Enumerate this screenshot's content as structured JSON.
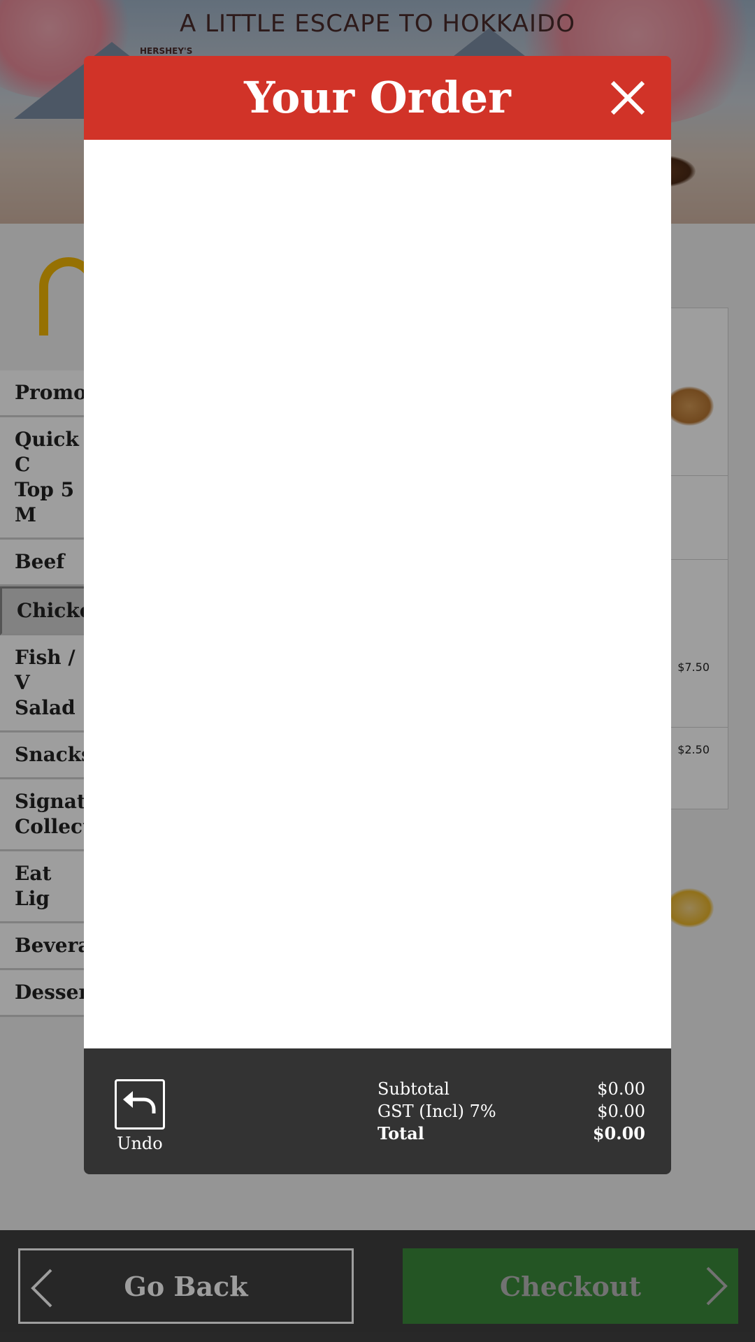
{
  "banner": {
    "title": "A LITTLE ESCAPE TO HOKKAIDO",
    "brand": "HERSHEY'S"
  },
  "categories": [
    {
      "label": "Promot",
      "selected": false
    },
    {
      "label": "Quick C\nTop 5 M",
      "selected": false
    },
    {
      "label": "Beef",
      "selected": false
    },
    {
      "label": "Chicke",
      "selected": true
    },
    {
      "label": "Fish / V\nSalad",
      "selected": false
    },
    {
      "label": "Snacks",
      "selected": false
    },
    {
      "label": "Signatu\nCollecti",
      "selected": false
    },
    {
      "label": "Eat Lig",
      "selected": false
    },
    {
      "label": "Bevera",
      "selected": false
    },
    {
      "label": "Dessert",
      "selected": false
    }
  ],
  "products": [
    {
      "price": "$7.50"
    },
    {
      "price": "$2.50"
    }
  ],
  "modal": {
    "title": "Your Order",
    "close_icon": "close-icon",
    "undo_label": "Undo",
    "undo_icon": "undo-icon",
    "totals": {
      "subtotal_label": "Subtotal",
      "subtotal_value": "$0.00",
      "gst_label": "GST (Incl) 7%",
      "gst_value": "$0.00",
      "total_label": "Total",
      "total_value": "$0.00"
    }
  },
  "bottom_bar": {
    "go_back_label": "Go Back",
    "checkout_label": "Checkout"
  },
  "colors": {
    "header_red": "#d13328",
    "checkout_green": "#3b8a3a",
    "footer_dark": "#333333",
    "logo_yellow": "#f2b705"
  }
}
